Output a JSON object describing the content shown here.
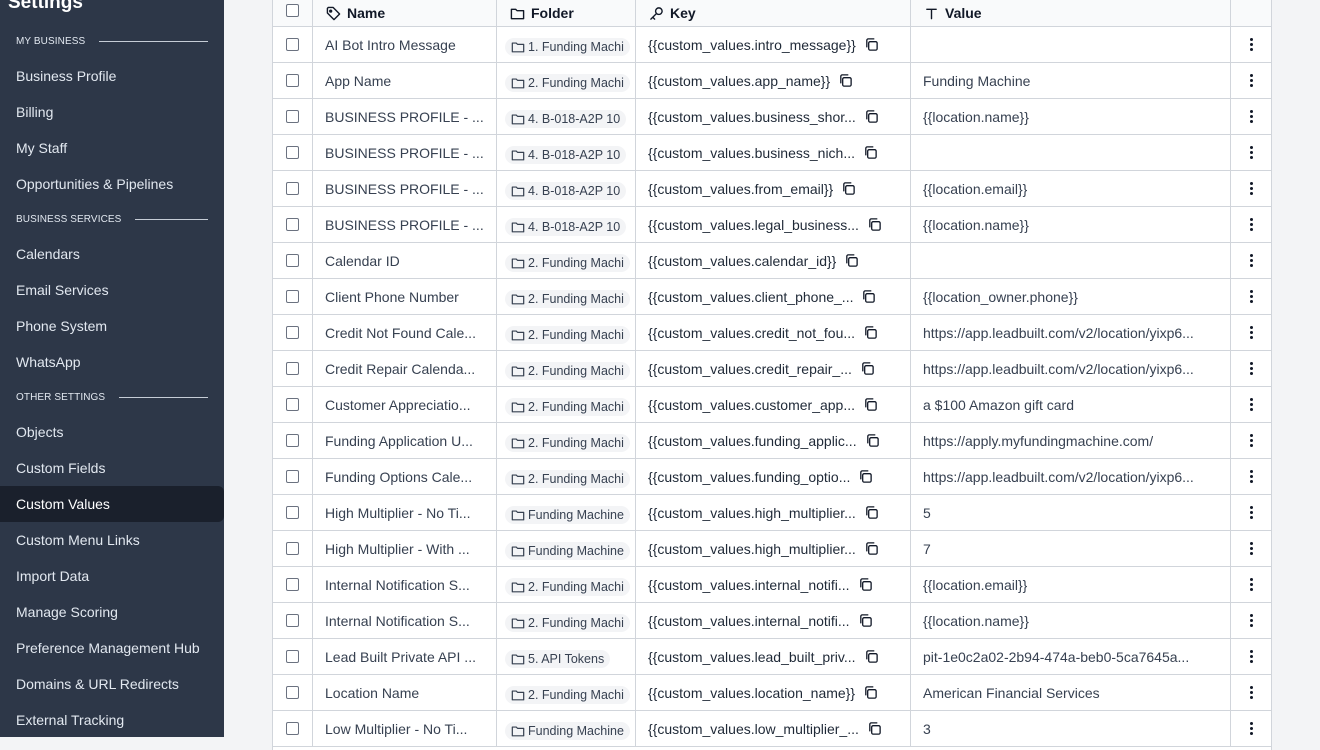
{
  "sidebar": {
    "title": "Settings",
    "sections": [
      {
        "label": "MY BUSINESS"
      },
      {
        "label": "BUSINESS SERVICES"
      },
      {
        "label": "OTHER SETTINGS"
      }
    ],
    "items": [
      {
        "label": "Business Profile"
      },
      {
        "label": "Billing"
      },
      {
        "label": "My Staff"
      },
      {
        "label": "Opportunities & Pipelines"
      },
      {
        "label": "Calendars"
      },
      {
        "label": "Email Services"
      },
      {
        "label": "Phone System"
      },
      {
        "label": "WhatsApp"
      },
      {
        "label": "Objects"
      },
      {
        "label": "Custom Fields"
      },
      {
        "label": "Custom Values",
        "active": true
      },
      {
        "label": "Custom Menu Links"
      },
      {
        "label": "Import Data"
      },
      {
        "label": "Manage Scoring"
      },
      {
        "label": "Preference Management Hub"
      },
      {
        "label": "Domains & URL Redirects"
      },
      {
        "label": "External Tracking"
      }
    ]
  },
  "table": {
    "headers": {
      "name": "Name",
      "folder": "Folder",
      "key": "Key",
      "value": "Value"
    },
    "rows": [
      {
        "name": "AI Bot Intro Message",
        "folder": "1. Funding Machi",
        "key": "{{custom_values.intro_message}}",
        "value": ""
      },
      {
        "name": "App Name",
        "folder": "2. Funding Machi",
        "key": "{{custom_values.app_name}}",
        "value": "Funding Machine"
      },
      {
        "name": "BUSINESS PROFILE - ...",
        "folder": "4. B-018-A2P 10",
        "key": "{{custom_values.business_shor...",
        "value": "{{location.name}}"
      },
      {
        "name": "BUSINESS PROFILE - ...",
        "folder": "4. B-018-A2P 10",
        "key": "{{custom_values.business_nich...",
        "value": ""
      },
      {
        "name": "BUSINESS PROFILE - ...",
        "folder": "4. B-018-A2P 10",
        "key": "{{custom_values.from_email}}",
        "value": "{{location.email}}"
      },
      {
        "name": "BUSINESS PROFILE - ...",
        "folder": "4. B-018-A2P 10",
        "key": "{{custom_values.legal_business...",
        "value": "{{location.name}}"
      },
      {
        "name": "Calendar ID",
        "folder": "2. Funding Machi",
        "key": "{{custom_values.calendar_id}}",
        "value": ""
      },
      {
        "name": "Client Phone Number",
        "folder": "2. Funding Machi",
        "key": "{{custom_values.client_phone_...",
        "value": "{{location_owner.phone}}"
      },
      {
        "name": "Credit Not Found Cale...",
        "folder": "2. Funding Machi",
        "key": "{{custom_values.credit_not_fou...",
        "value": "https://app.leadbuilt.com/v2/location/yixp6..."
      },
      {
        "name": "Credit Repair Calenda...",
        "folder": "2. Funding Machi",
        "key": "{{custom_values.credit_repair_...",
        "value": "https://app.leadbuilt.com/v2/location/yixp6..."
      },
      {
        "name": "Customer Appreciatio...",
        "folder": "2. Funding Machi",
        "key": "{{custom_values.customer_app...",
        "value": "a $100 Amazon gift card"
      },
      {
        "name": "Funding Application U...",
        "folder": "2. Funding Machi",
        "key": "{{custom_values.funding_applic...",
        "value": "https://apply.myfundingmachine.com/"
      },
      {
        "name": "Funding Options Cale...",
        "folder": "2. Funding Machi",
        "key": "{{custom_values.funding_optio...",
        "value": "https://app.leadbuilt.com/v2/location/yixp6..."
      },
      {
        "name": "High Multiplier - No Ti...",
        "folder": "Funding Machine",
        "key": "{{custom_values.high_multiplier...",
        "value": "5"
      },
      {
        "name": "High Multiplier - With ...",
        "folder": "Funding Machine",
        "key": "{{custom_values.high_multiplier...",
        "value": "7"
      },
      {
        "name": "Internal Notification S...",
        "folder": "2. Funding Machi",
        "key": "{{custom_values.internal_notifi...",
        "value": "{{location.email}}"
      },
      {
        "name": "Internal Notification S...",
        "folder": "2. Funding Machi",
        "key": "{{custom_values.internal_notifi...",
        "value": "{{location.name}}"
      },
      {
        "name": "Lead Built Private API ...",
        "folder": "5. API Tokens",
        "key": "{{custom_values.lead_built_priv...",
        "value": "pit-1e0c2a02-2b94-474a-beb0-5ca7645a..."
      },
      {
        "name": "Location Name",
        "folder": "2. Funding Machi",
        "key": "{{custom_values.location_name}}",
        "value": "American Financial Services"
      },
      {
        "name": "Low Multiplier - No Ti...",
        "folder": "Funding Machine",
        "key": "{{custom_values.low_multiplier_...",
        "value": "3"
      }
    ]
  }
}
